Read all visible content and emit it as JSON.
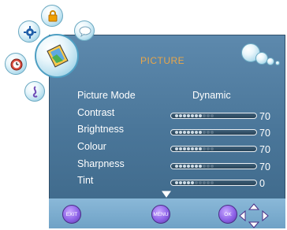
{
  "menu": {
    "title": "PICTURE",
    "rows": [
      {
        "label": "Picture Mode",
        "value": "Dynamic"
      },
      {
        "label": "Contrast",
        "value": "70",
        "level": 0.7
      },
      {
        "label": "Brightness",
        "value": "70",
        "level": 0.7
      },
      {
        "label": "Colour",
        "value": "70",
        "level": 0.7
      },
      {
        "label": "Sharpness",
        "value": "70",
        "level": 0.7
      },
      {
        "label": "Tint",
        "value": "0",
        "level": 0.5
      }
    ]
  },
  "buttons": {
    "exit": "EXIT",
    "menu": "MENU",
    "ok": "OK"
  },
  "icons": [
    "lock-icon",
    "gear-icon",
    "picture-icon",
    "sound-icon",
    "clock-icon",
    "chat-icon",
    "bubbles-icon",
    "scroll-down-icon",
    "dpad-icon"
  ],
  "colors": {
    "title": "#e8a64a",
    "panel": "#4a7699",
    "bottom": "#7aaed1"
  }
}
